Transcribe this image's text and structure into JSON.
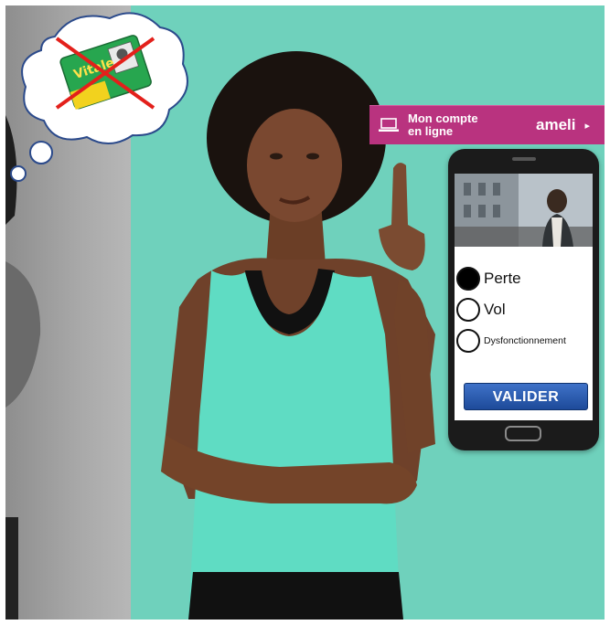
{
  "scene": {
    "description_colors": {
      "background_teal": "#6fd1bc",
      "banner_magenta": "#b9337f",
      "button_blue": "#2a5cb0"
    }
  },
  "thought_bubble": {
    "card_label": "Vitale",
    "icon": "vitale-card-crossed-icon"
  },
  "banner": {
    "icon": "laptop-icon",
    "account_label_line1": "Mon compte",
    "account_label_line2": "en ligne",
    "brand": "ameli",
    "arrow": "▸"
  },
  "phone": {
    "options": [
      {
        "label": "Perte",
        "selected": true
      },
      {
        "label": "Vol",
        "selected": false
      },
      {
        "label": "Dysfonctionnement",
        "selected": false
      }
    ],
    "submit_label": "VALIDER"
  }
}
